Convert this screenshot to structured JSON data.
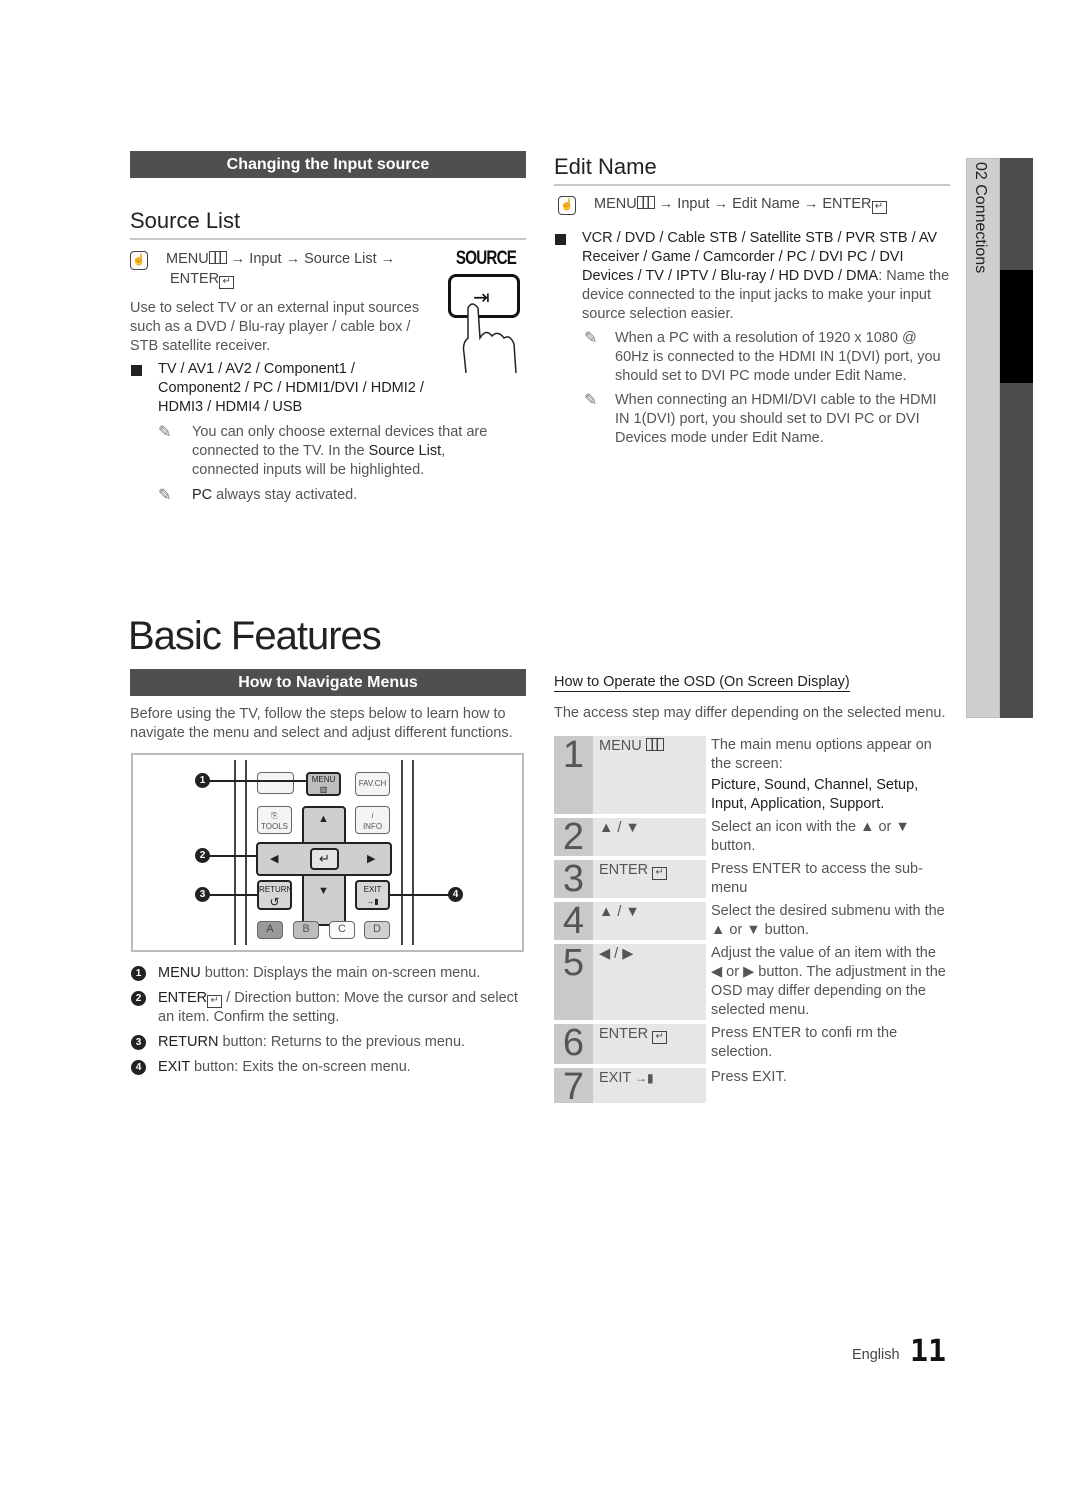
{
  "top_section": {
    "bar_title": "Changing the Input source",
    "source_list": {
      "heading": "Source List",
      "path_menu": "MENU",
      "path_rest": "→ Input → Source List →",
      "path_enter": "ENTER",
      "source_button_label": "SOURCE",
      "description": "Use to select TV or an external input sources such as a DVD / Blu-ray player / cable box / STB satellite receiver.",
      "bullet": "TV / AV1 / AV2 / Component1 / Component2 / PC / HDMI1/DVI / HDMI2 / HDMI3 / HDMI4 / USB",
      "notes": [
        {
          "pre": "You can only choose external devices that are connected to the TV. In the ",
          "bold": "Source List",
          "post": ", connected inputs will be highlighted."
        },
        {
          "pre": "",
          "bold": "PC",
          "post": " always stay activated."
        }
      ]
    },
    "edit_name": {
      "heading": "Edit Name",
      "path_menu": "MENU",
      "path_rest": "→ Input → Edit Name → ENTER",
      "bullet_bold": "VCR / DVD / Cable STB / Satellite STB / PVR STB / AV Receiver / Game / Camcorder / PC / DVI PC / DVI Devices / TV / IPTV / Blu-ray / HD DVD / DMA",
      "bullet_rest": ": Name the device connected to the input jacks to make your input source selection easier.",
      "notes": [
        "When a PC with a resolution of 1920 x 1080 @ 60Hz is connected to the HDMI IN 1(DVI) port, you should set to DVI PC mode under Edit Name.",
        "When connecting an HDMI/DVI cable to the HDMI IN 1(DVI) port, you should set to DVI PC or DVI Devices mode under Edit Name."
      ]
    }
  },
  "basic_features": {
    "title": "Basic Features",
    "navigate": {
      "bar_title": "How to Navigate Menus",
      "intro": "Before using the TV, follow the steps below to learn how to navigate the menu and select and adjust different functions.",
      "remote": {
        "menu": "MENU",
        "favch": "FAV.CH",
        "tools": "TOOLS",
        "info": "INFO",
        "return": "RETURN",
        "exit": "EXIT",
        "colors": [
          "A",
          "B",
          "C",
          "D"
        ],
        "callouts": [
          "1",
          "2",
          "3",
          "4"
        ]
      },
      "legend": [
        {
          "num": "1",
          "key": "MENU",
          "text": " button: Displays the main on-screen menu."
        },
        {
          "num": "2",
          "key": "ENTER",
          "text": " / Direction button: Move the cursor and select an item. Confirm the setting."
        },
        {
          "num": "3",
          "key": "RETURN",
          "text": " button: Returns to the previous menu."
        },
        {
          "num": "4",
          "key": "EXIT",
          "text": " button: Exits the on-screen menu."
        }
      ]
    },
    "osd": {
      "heading": "How to Operate the OSD (On Screen Display)",
      "intro": "The access step may differ depending on the selected menu.",
      "steps": [
        {
          "num": "1",
          "key": "MENU",
          "desc": "The main menu options appear on the screen:",
          "desc_bold": "Picture, Sound, Channel, Setup, Input, Application, Support."
        },
        {
          "num": "2",
          "key": "▲ / ▼",
          "desc": "Select an icon with the ▲ or ▼ button."
        },
        {
          "num": "3",
          "key": "ENTER",
          "desc": "Press ENTER to access the sub-menu"
        },
        {
          "num": "4",
          "key": "▲ / ▼",
          "desc": "Select the desired submenu with the ▲ or ▼ button."
        },
        {
          "num": "5",
          "key": "◀ / ▶",
          "desc": "Adjust the value of an item with the ◀ or ▶ button. The adjustment in the OSD may differ depending on the selected menu."
        },
        {
          "num": "6",
          "key": "ENTER",
          "desc": "Press ENTER to confi rm the selection."
        },
        {
          "num": "7",
          "key": "EXIT",
          "desc": "Press EXIT."
        }
      ]
    }
  },
  "side_tab": {
    "chapter": "02  Connections"
  },
  "footer": {
    "language": "English",
    "page": "11"
  }
}
